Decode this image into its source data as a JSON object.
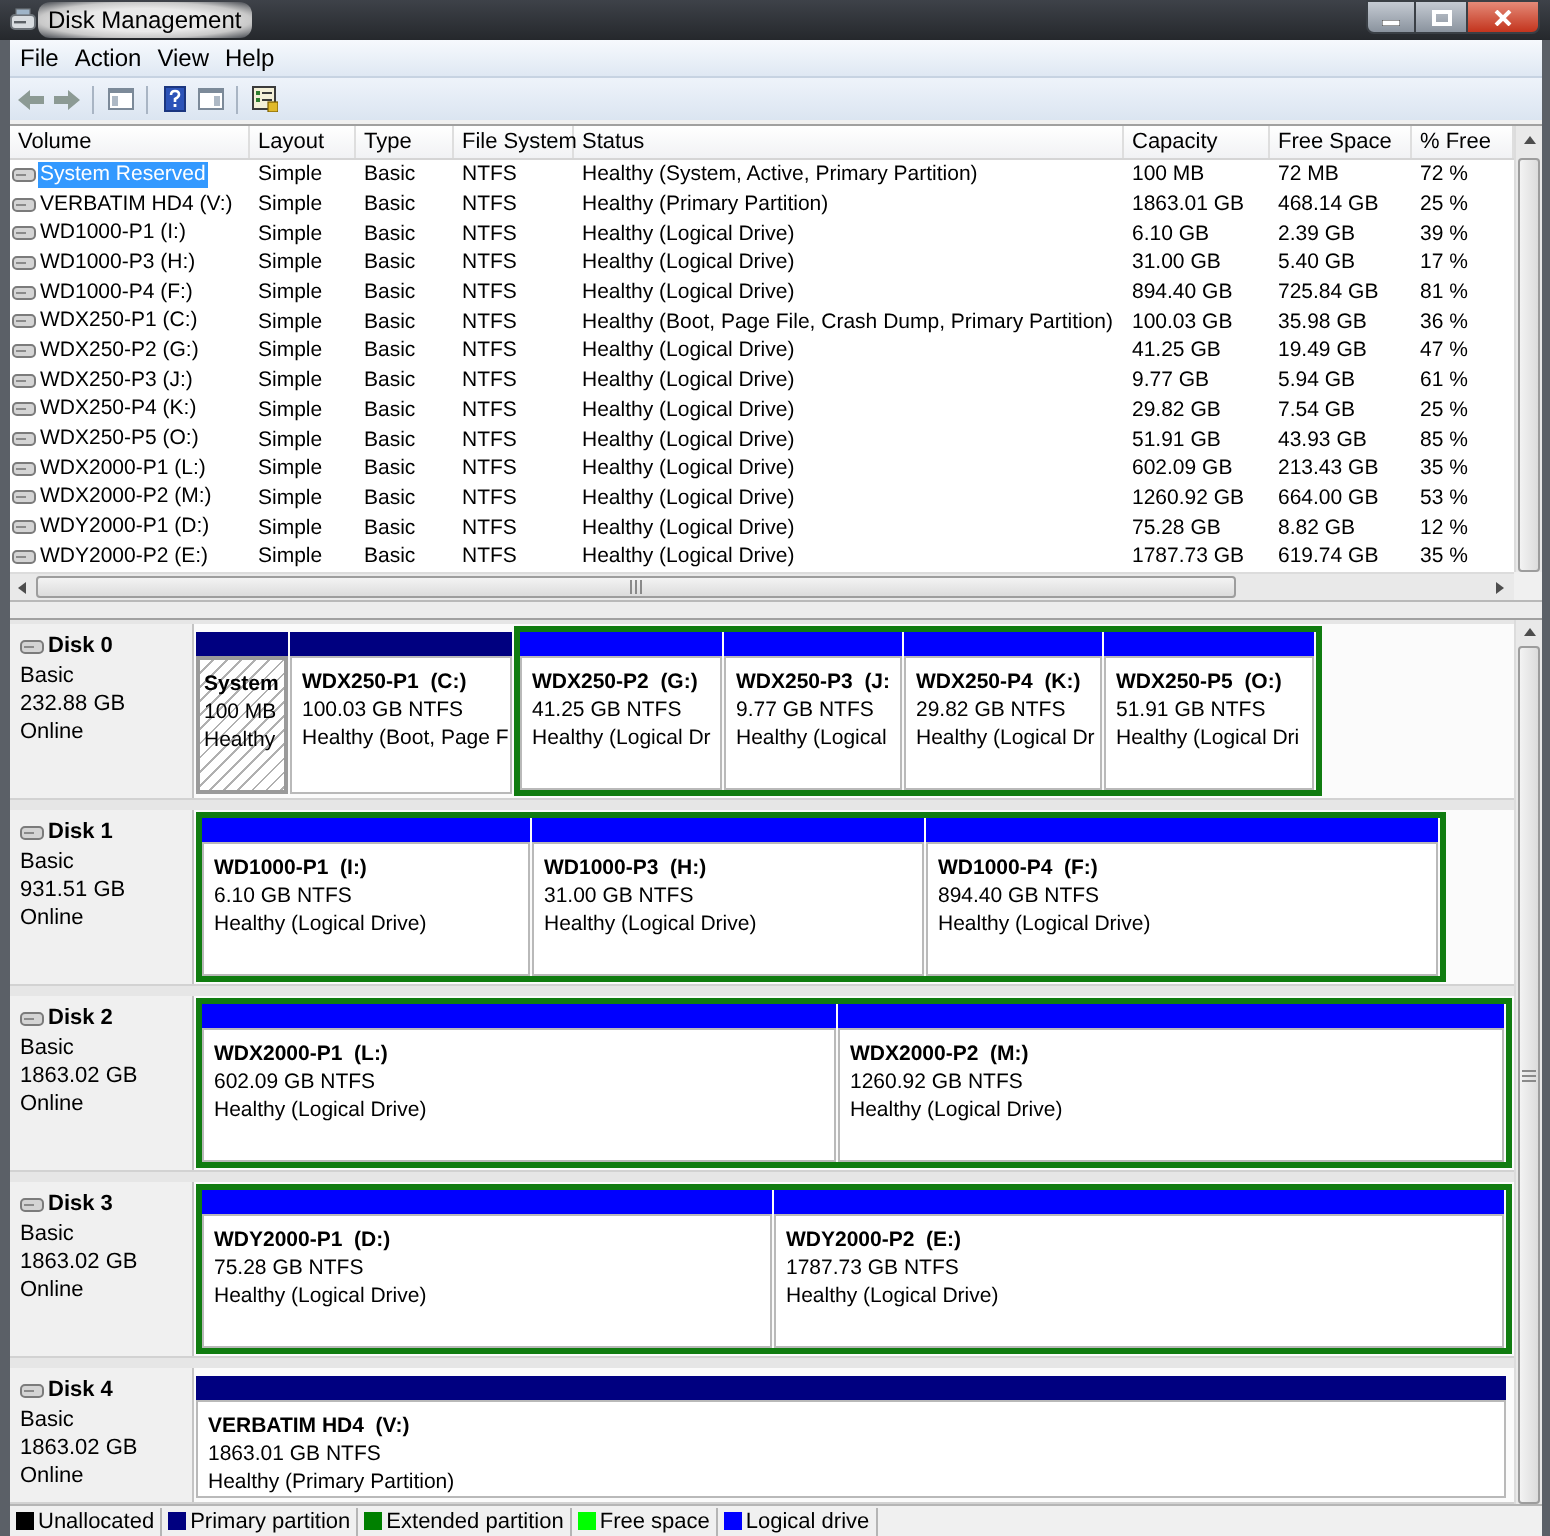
{
  "window": {
    "title": "Disk Management"
  },
  "menu": [
    "File",
    "Action",
    "View",
    "Help"
  ],
  "table": {
    "columns": [
      "Volume",
      "Layout",
      "Type",
      "File System",
      "Status",
      "Capacity",
      "Free Space",
      "% Free"
    ],
    "rows": [
      {
        "volume": "System Reserved",
        "layout": "Simple",
        "type": "Basic",
        "file_system": "NTFS",
        "status": "Healthy (System, Active, Primary Partition)",
        "capacity": "100 MB",
        "free_space": "72 MB",
        "percent_free": "72 %",
        "selected": true
      },
      {
        "volume": "VERBATIM HD4 (V:)",
        "layout": "Simple",
        "type": "Basic",
        "file_system": "NTFS",
        "status": "Healthy (Primary Partition)",
        "capacity": "1863.01 GB",
        "free_space": "468.14 GB",
        "percent_free": "25 %",
        "selected": false
      },
      {
        "volume": "WD1000-P1 (I:)",
        "layout": "Simple",
        "type": "Basic",
        "file_system": "NTFS",
        "status": "Healthy (Logical Drive)",
        "capacity": "6.10 GB",
        "free_space": "2.39 GB",
        "percent_free": "39 %",
        "selected": false
      },
      {
        "volume": "WD1000-P3 (H:)",
        "layout": "Simple",
        "type": "Basic",
        "file_system": "NTFS",
        "status": "Healthy (Logical Drive)",
        "capacity": "31.00 GB",
        "free_space": "5.40 GB",
        "percent_free": "17 %",
        "selected": false
      },
      {
        "volume": "WD1000-P4 (F:)",
        "layout": "Simple",
        "type": "Basic",
        "file_system": "NTFS",
        "status": "Healthy (Logical Drive)",
        "capacity": "894.40 GB",
        "free_space": "725.84 GB",
        "percent_free": "81 %",
        "selected": false
      },
      {
        "volume": "WDX250-P1 (C:)",
        "layout": "Simple",
        "type": "Basic",
        "file_system": "NTFS",
        "status": "Healthy (Boot, Page File, Crash Dump, Primary Partition)",
        "capacity": "100.03 GB",
        "free_space": "35.98 GB",
        "percent_free": "36 %",
        "selected": false
      },
      {
        "volume": "WDX250-P2 (G:)",
        "layout": "Simple",
        "type": "Basic",
        "file_system": "NTFS",
        "status": "Healthy (Logical Drive)",
        "capacity": "41.25 GB",
        "free_space": "19.49 GB",
        "percent_free": "47 %",
        "selected": false
      },
      {
        "volume": "WDX250-P3 (J:)",
        "layout": "Simple",
        "type": "Basic",
        "file_system": "NTFS",
        "status": "Healthy (Logical Drive)",
        "capacity": "9.77 GB",
        "free_space": "5.94 GB",
        "percent_free": "61 %",
        "selected": false
      },
      {
        "volume": "WDX250-P4 (K:)",
        "layout": "Simple",
        "type": "Basic",
        "file_system": "NTFS",
        "status": "Healthy (Logical Drive)",
        "capacity": "29.82 GB",
        "free_space": "7.54 GB",
        "percent_free": "25 %",
        "selected": false
      },
      {
        "volume": "WDX250-P5 (O:)",
        "layout": "Simple",
        "type": "Basic",
        "file_system": "NTFS",
        "status": "Healthy (Logical Drive)",
        "capacity": "51.91 GB",
        "free_space": "43.93 GB",
        "percent_free": "85 %",
        "selected": false
      },
      {
        "volume": "WDX2000-P1 (L:)",
        "layout": "Simple",
        "type": "Basic",
        "file_system": "NTFS",
        "status": "Healthy (Logical Drive)",
        "capacity": "602.09 GB",
        "free_space": "213.43 GB",
        "percent_free": "35 %",
        "selected": false
      },
      {
        "volume": "WDX2000-P2 (M:)",
        "layout": "Simple",
        "type": "Basic",
        "file_system": "NTFS",
        "status": "Healthy (Logical Drive)",
        "capacity": "1260.92 GB",
        "free_space": "664.00 GB",
        "percent_free": "53 %",
        "selected": false
      },
      {
        "volume": "WDY2000-P1 (D:)",
        "layout": "Simple",
        "type": "Basic",
        "file_system": "NTFS",
        "status": "Healthy (Logical Drive)",
        "capacity": "75.28 GB",
        "free_space": "8.82 GB",
        "percent_free": "12 %",
        "selected": false
      },
      {
        "volume": "WDY2000-P2 (E:)",
        "layout": "Simple",
        "type": "Basic",
        "file_system": "NTFS",
        "status": "Healthy (Logical Drive)",
        "capacity": "1787.73 GB",
        "free_space": "619.74 GB",
        "percent_free": "35 %",
        "selected": false
      }
    ]
  },
  "disks": [
    {
      "name": "Disk 0",
      "type": "Basic",
      "size": "232.88 GB",
      "status": "Online",
      "partitions": [
        {
          "kind": "primary",
          "name": "System",
          "size": "100 MB",
          "status": "Healthy",
          "selected": true
        },
        {
          "kind": "primary",
          "name": "WDX250-P1  (C:)",
          "size": "100.03 GB NTFS",
          "status": "Healthy (Boot, Page F",
          "selected": false
        },
        {
          "kind": "extended",
          "selected": false,
          "children": [
            {
              "kind": "logical",
              "name": "WDX250-P2  (G:)",
              "size": "41.25 GB NTFS",
              "status": "Healthy (Logical Dr",
              "selected": false
            },
            {
              "kind": "logical",
              "name": "WDX250-P3  (J:",
              "size": "9.77 GB NTFS",
              "status": "Healthy (Logical",
              "selected": false
            },
            {
              "kind": "logical",
              "name": "WDX250-P4  (K:)",
              "size": "29.82 GB NTFS",
              "status": "Healthy (Logical Dr",
              "selected": false
            },
            {
              "kind": "logical",
              "name": "WDX250-P5  (O:)",
              "size": "51.91 GB NTFS",
              "status": "Healthy (Logical Dri",
              "selected": false
            }
          ]
        }
      ]
    },
    {
      "name": "Disk 1",
      "type": "Basic",
      "size": "931.51 GB",
      "status": "Online",
      "partitions": [
        {
          "kind": "extended",
          "selected": false,
          "children": [
            {
              "kind": "logical",
              "name": "WD1000-P1  (I:)",
              "size": "6.10 GB NTFS",
              "status": "Healthy (Logical Drive)",
              "selected": false
            },
            {
              "kind": "logical",
              "name": "WD1000-P3  (H:)",
              "size": "31.00 GB NTFS",
              "status": "Healthy (Logical Drive)",
              "selected": false
            },
            {
              "kind": "logical",
              "name": "WD1000-P4  (F:)",
              "size": "894.40 GB NTFS",
              "status": "Healthy (Logical Drive)",
              "selected": false
            }
          ]
        }
      ]
    },
    {
      "name": "Disk 2",
      "type": "Basic",
      "size": "1863.02 GB",
      "status": "Online",
      "partitions": [
        {
          "kind": "extended",
          "selected": false,
          "children": [
            {
              "kind": "logical",
              "name": "WDX2000-P1  (L:)",
              "size": "602.09 GB NTFS",
              "status": "Healthy (Logical Drive)",
              "selected": false
            },
            {
              "kind": "logical",
              "name": "WDX2000-P2  (M:)",
              "size": "1260.92 GB NTFS",
              "status": "Healthy (Logical Drive)",
              "selected": false
            }
          ]
        }
      ]
    },
    {
      "name": "Disk 3",
      "type": "Basic",
      "size": "1863.02 GB",
      "status": "Online",
      "partitions": [
        {
          "kind": "extended",
          "selected": false,
          "children": [
            {
              "kind": "logical",
              "name": "WDY2000-P1  (D:)",
              "size": "75.28 GB NTFS",
              "status": "Healthy (Logical Drive)",
              "selected": false
            },
            {
              "kind": "logical",
              "name": "WDY2000-P2  (E:)",
              "size": "1787.73 GB NTFS",
              "status": "Healthy (Logical Drive)",
              "selected": false
            }
          ]
        }
      ]
    },
    {
      "name": "Disk 4",
      "type": "Basic",
      "size": "1863.02 GB",
      "status": "Online",
      "partitions": [
        {
          "kind": "primary",
          "name": "VERBATIM HD4  (V:)",
          "size": "1863.01 GB NTFS",
          "status": "Healthy (Primary Partition)",
          "selected": false
        }
      ]
    }
  ],
  "legend": [
    {
      "label": "Unallocated",
      "color": "#000000"
    },
    {
      "label": "Primary partition",
      "color": "#000080"
    },
    {
      "label": "Extended partition",
      "color": "#008000"
    },
    {
      "label": "Free space",
      "color": "#00ff00"
    },
    {
      "label": "Logical drive",
      "color": "#0000ff"
    }
  ]
}
